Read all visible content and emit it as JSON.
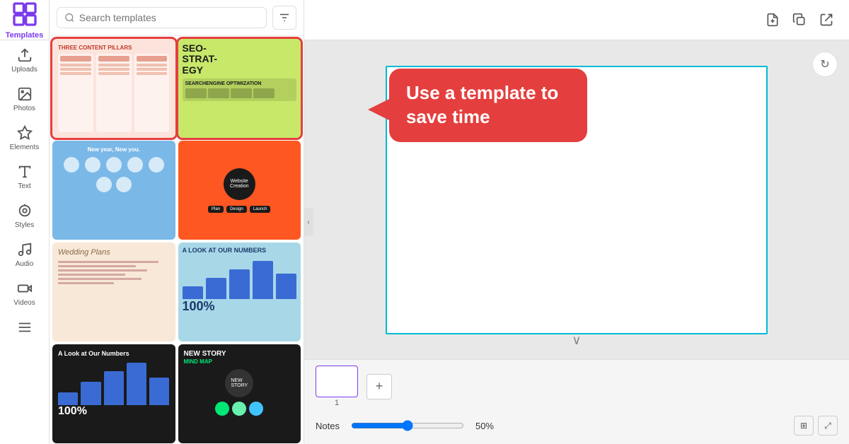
{
  "sidebar": {
    "title": "Templates",
    "items": [
      {
        "label": "Uploads",
        "icon": "upload-icon"
      },
      {
        "label": "Photos",
        "icon": "photos-icon"
      },
      {
        "label": "Elements",
        "icon": "elements-icon"
      },
      {
        "label": "Text",
        "icon": "text-icon"
      },
      {
        "label": "Styles",
        "icon": "styles-icon"
      },
      {
        "label": "Audio",
        "icon": "audio-icon"
      },
      {
        "label": "Videos",
        "icon": "videos-icon"
      },
      {
        "label": "More",
        "icon": "more-icon"
      }
    ]
  },
  "search": {
    "placeholder": "Search templates",
    "value": ""
  },
  "tooltip": {
    "text": "Use a template to save time"
  },
  "toolbar": {
    "add_page_label": "+",
    "notes_label": "Notes",
    "zoom_percent": "50%",
    "page_number": "1"
  },
  "templates": {
    "cards": [
      {
        "id": 1,
        "alt": "Three Content Pillars template"
      },
      {
        "id": 2,
        "alt": "SEO Strategy template"
      },
      {
        "id": 3,
        "alt": "Circles diagram template"
      },
      {
        "id": 4,
        "alt": "Website Creation mind map"
      },
      {
        "id": 5,
        "alt": "Wedding Plans template"
      },
      {
        "id": 6,
        "alt": "A Look at Our Numbers template"
      },
      {
        "id": 7,
        "alt": "A Look at Our Numbers dark template"
      },
      {
        "id": 8,
        "alt": "New Story Mind Map template"
      }
    ]
  },
  "icons": {
    "search": "🔍",
    "filter": "⚙",
    "collapse": "‹",
    "refresh": "↻",
    "chevron_down": "∨",
    "add": "+",
    "new_page": "⊞",
    "duplicate": "⧉",
    "share": "↑"
  }
}
